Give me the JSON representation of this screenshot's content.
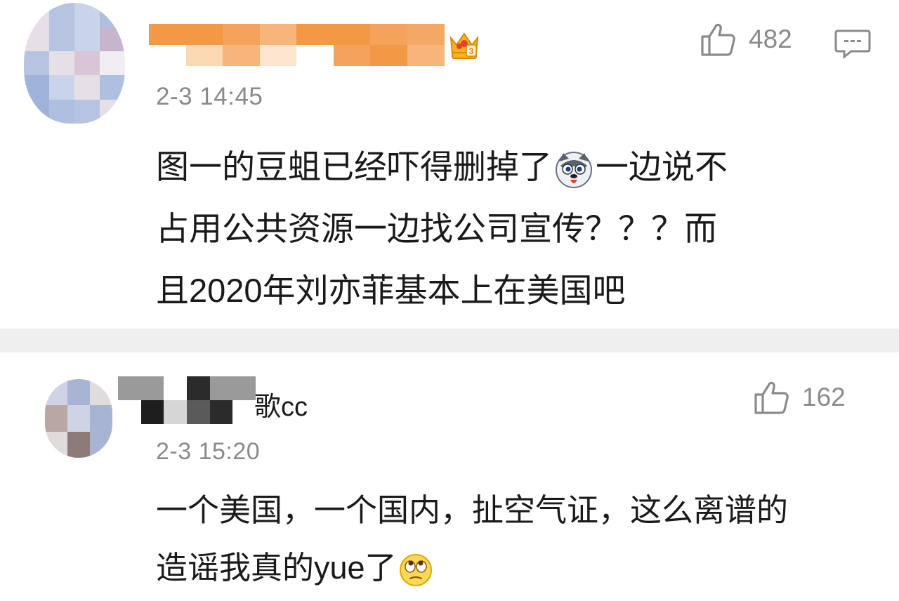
{
  "comments": [
    {
      "username_visible_suffix": "",
      "timestamp": "2-3 14:45",
      "like_count": "482",
      "text_lines": [
        "图一的豆蛆已经吓得删掉了",
        "一边说不",
        "占用公共资源一边找公司宣传？？？而",
        "且2020年刘亦菲基本上在美国吧"
      ],
      "emoji": "husky-emoji",
      "badge": "crown-level-3-icon",
      "badge_level": "3"
    },
    {
      "username_visible_suffix": "歌cc",
      "timestamp": "2-3 15:20",
      "like_count": "162",
      "text_lines": [
        "一个美国，一个国内，扯空气证，这么离谱的",
        "造谣我真的yue了"
      ],
      "emoji": "rolling-eyes-emoji"
    }
  ],
  "icons": {
    "like": "thumbs-up-icon",
    "reply": "comment-bubble-icon"
  },
  "colors": {
    "name_blur_orange": "#f5a25a",
    "meta_gray": "#8a8a8a",
    "separator": "#efefef"
  }
}
